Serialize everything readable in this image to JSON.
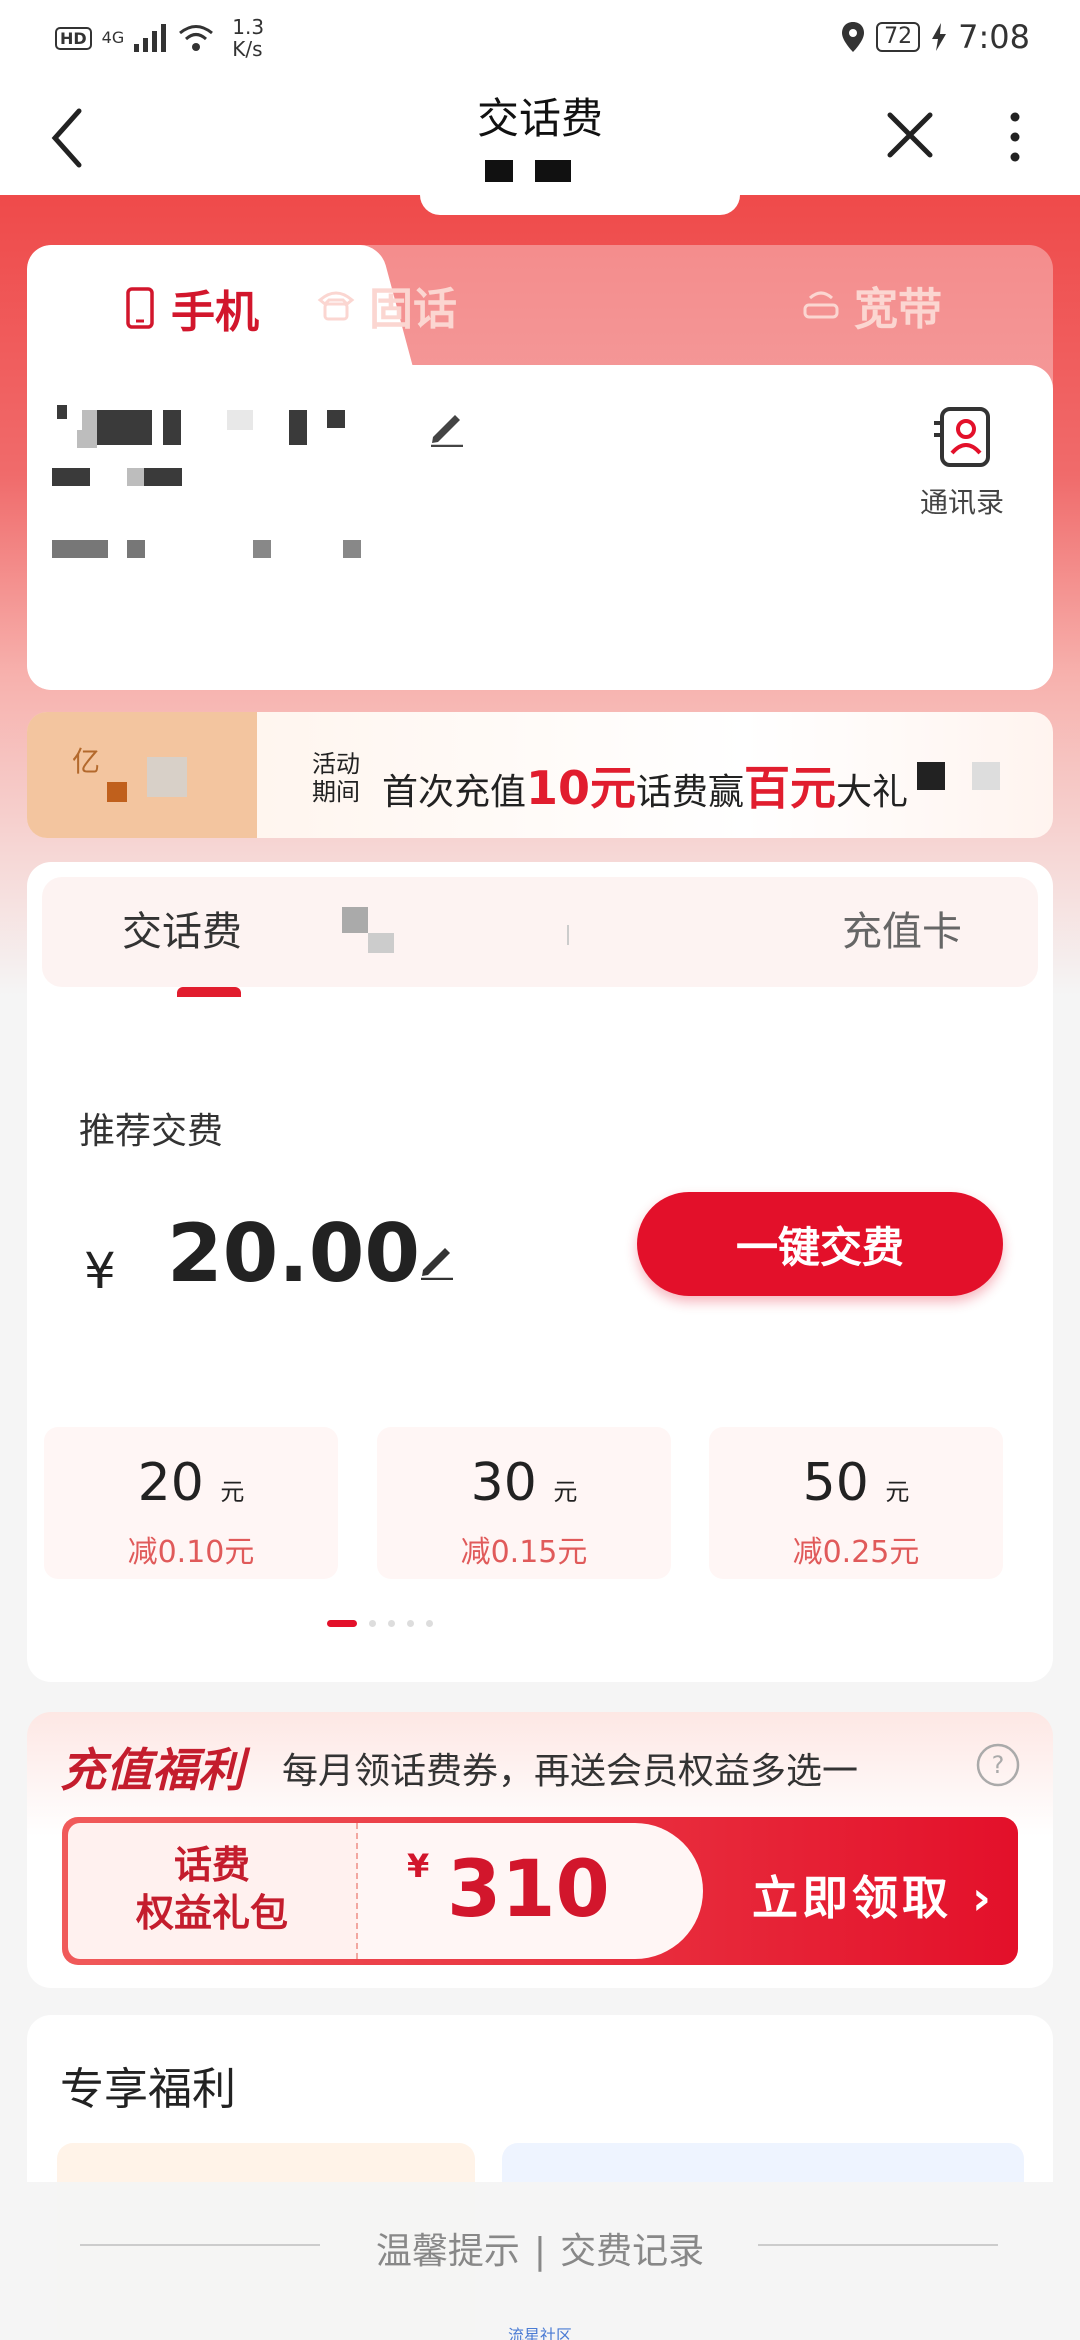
{
  "status_bar": {
    "hd": "HD",
    "network": "4G",
    "speed_value": "1.3",
    "speed_unit": "K/s",
    "battery": "72",
    "time": "7:08"
  },
  "nav": {
    "title": "交话费",
    "back_icon": "chevron-left-icon",
    "close_icon": "close-icon",
    "more_icon": "more-vertical-icon"
  },
  "top_tabs": [
    {
      "label": "手机",
      "icon": "mobile-phone-icon",
      "active": true
    },
    {
      "label": "固话",
      "icon": "landline-phone-icon",
      "active": false
    },
    {
      "label": "宽带",
      "icon": "router-icon",
      "active": false
    }
  ],
  "contacts": {
    "label": "通讯录",
    "icon": "contacts-icon"
  },
  "promo": {
    "left_text": "亿",
    "period": "活动期间",
    "text_a": "首次充值",
    "highlight_a": "10元",
    "text_b": "话费赢",
    "highlight_b": "百元",
    "text_c": "大礼"
  },
  "sub_tabs": [
    {
      "label": "交话费",
      "active": true
    },
    {
      "label": "",
      "active": false
    },
    {
      "label": "充值卡",
      "active": false
    }
  ],
  "recharge": {
    "title": "推荐交费",
    "currency": "¥",
    "amount": "20.00",
    "pay_button": "一键交费",
    "options": [
      {
        "value": "20",
        "unit": "元",
        "discount": "减0.10元"
      },
      {
        "value": "30",
        "unit": "元",
        "discount": "减0.15元"
      },
      {
        "value": "50",
        "unit": "元",
        "discount": "减0.25元"
      }
    ],
    "page_dots": 5,
    "page_active": 0
  },
  "benefit": {
    "title": "充值福利",
    "desc": "每月领话费券，再送会员权益多选一",
    "coupon_name_line1": "话费",
    "coupon_name_line2": "权益礼包",
    "coupon_currency": "¥",
    "coupon_amount": "310",
    "coupon_cta": "立即领取 ›"
  },
  "exclusive": {
    "title": "专享福利"
  },
  "bottom": {
    "tips": "温馨提示",
    "separator": "|",
    "records": "交费记录",
    "watermark": "流星社区"
  },
  "colors": {
    "brand_red": "#e3102a",
    "accent_red": "#d2162c"
  }
}
